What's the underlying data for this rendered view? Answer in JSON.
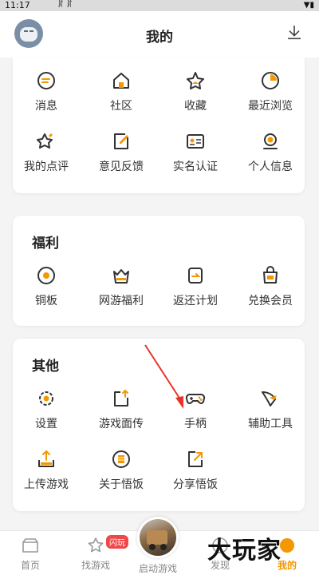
{
  "status_bar": {
    "time": "11:17",
    "notifications": "ꊲ ꊲ"
  },
  "header": {
    "title": "我的"
  },
  "section_top": {
    "items": [
      {
        "label": "消息",
        "icon": "message-icon"
      },
      {
        "label": "社区",
        "icon": "community-icon"
      },
      {
        "label": "收藏",
        "icon": "favorite-icon"
      },
      {
        "label": "最近浏览",
        "icon": "recent-icon"
      },
      {
        "label": "我的点评",
        "icon": "review-icon"
      },
      {
        "label": "意见反馈",
        "icon": "feedback-icon"
      },
      {
        "label": "实名认证",
        "icon": "id-card-icon"
      },
      {
        "label": "个人信息",
        "icon": "profile-icon"
      }
    ]
  },
  "section_welfare": {
    "title": "福利",
    "items": [
      {
        "label": "铜板",
        "icon": "coin-icon"
      },
      {
        "label": "网游福利",
        "icon": "gift-icon"
      },
      {
        "label": "返还计划",
        "icon": "refund-icon"
      },
      {
        "label": "兑换会员",
        "icon": "vip-bag-icon"
      }
    ]
  },
  "section_other": {
    "title": "其他",
    "items": [
      {
        "label": "设置",
        "icon": "gear-icon"
      },
      {
        "label": "游戏面传",
        "icon": "share-upload-icon"
      },
      {
        "label": "手柄",
        "icon": "gamepad-icon"
      },
      {
        "label": "辅助工具",
        "icon": "wing-icon"
      },
      {
        "label": "上传游戏",
        "icon": "upload-icon"
      },
      {
        "label": "关于悟饭",
        "icon": "about-icon"
      },
      {
        "label": "分享悟饭",
        "icon": "share-icon"
      }
    ]
  },
  "tabbar": {
    "tabs": [
      {
        "label": "首页",
        "icon": "home-icon"
      },
      {
        "label": "找游戏",
        "icon": "star-icon",
        "badge": "闪玩"
      },
      {
        "label": "启动游戏",
        "icon": "game-cover-icon"
      },
      {
        "label": "发现",
        "icon": "discover-icon"
      },
      {
        "label": "我的",
        "icon": "me-icon",
        "active": true
      }
    ]
  },
  "watermark": "大玩家",
  "colors": {
    "accent": "#f39800",
    "icon": "#333333",
    "badge": "#f04848"
  }
}
